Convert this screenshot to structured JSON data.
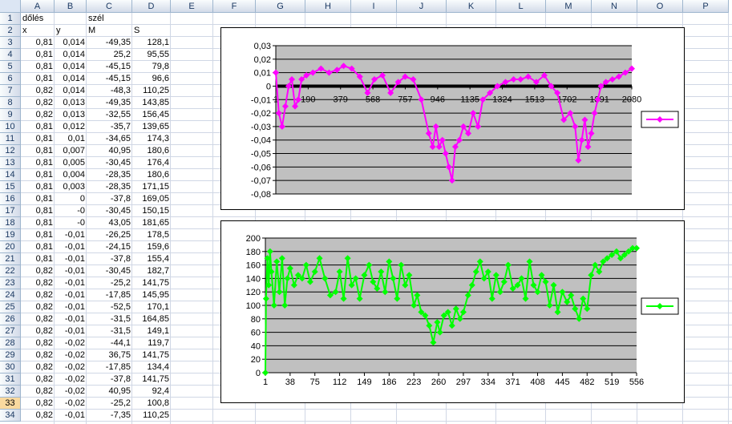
{
  "spreadsheet": {
    "columns": [
      "A",
      "B",
      "C",
      "D",
      "E",
      "F",
      "G",
      "H",
      "I",
      "J",
      "K",
      "L",
      "M",
      "N",
      "O",
      "P"
    ],
    "rows": [
      "1",
      "2",
      "3",
      "4",
      "5",
      "6",
      "7",
      "8",
      "9",
      "10",
      "11",
      "12",
      "13",
      "14",
      "15",
      "16",
      "17",
      "18",
      "19",
      "20",
      "21",
      "22",
      "23",
      "24",
      "25",
      "26",
      "27",
      "28",
      "29",
      "30",
      "31",
      "32",
      "33",
      "34"
    ],
    "selected_row": "33",
    "cells": {
      "A1": "dőlés",
      "C1": "szél",
      "A2": "x",
      "B2": "y",
      "C2": "M",
      "D2": "S"
    },
    "table": [
      [
        "0,81",
        "0,014",
        "-49,35",
        "128,1"
      ],
      [
        "0,81",
        "0,014",
        "25,2",
        "95,55"
      ],
      [
        "0,81",
        "0,014",
        "-45,15",
        "79,8"
      ],
      [
        "0,81",
        "0,014",
        "-45,15",
        "96,6"
      ],
      [
        "0,82",
        "0,014",
        "-48,3",
        "110,25"
      ],
      [
        "0,82",
        "0,013",
        "-49,35",
        "143,85"
      ],
      [
        "0,82",
        "0,013",
        "-32,55",
        "156,45"
      ],
      [
        "0,81",
        "0,012",
        "-35,7",
        "139,65"
      ],
      [
        "0,81",
        "0,01",
        "-34,65",
        "174,3"
      ],
      [
        "0,81",
        "0,007",
        "40,95",
        "180,6"
      ],
      [
        "0,81",
        "0,005",
        "-30,45",
        "176,4"
      ],
      [
        "0,81",
        "0,004",
        "-28,35",
        "180,6"
      ],
      [
        "0,81",
        "0,003",
        "-28,35",
        "171,15"
      ],
      [
        "0,81",
        "0",
        "-37,8",
        "169,05"
      ],
      [
        "0,81",
        "-0",
        "-30,45",
        "150,15"
      ],
      [
        "0,81",
        "-0",
        "43,05",
        "181,65"
      ],
      [
        "0,81",
        "-0,01",
        "-26,25",
        "178,5"
      ],
      [
        "0,81",
        "-0,01",
        "-24,15",
        "159,6"
      ],
      [
        "0,81",
        "-0,01",
        "-37,8",
        "155,4"
      ],
      [
        "0,82",
        "-0,01",
        "-30,45",
        "182,7"
      ],
      [
        "0,82",
        "-0,01",
        "-25,2",
        "141,75"
      ],
      [
        "0,82",
        "-0,01",
        "-17,85",
        "145,95"
      ],
      [
        "0,82",
        "-0,01",
        "-52,5",
        "170,1"
      ],
      [
        "0,82",
        "-0,01",
        "-31,5",
        "164,85"
      ],
      [
        "0,82",
        "-0,01",
        "-31,5",
        "149,1"
      ],
      [
        "0,82",
        "-0,02",
        "-44,1",
        "119,7"
      ],
      [
        "0,82",
        "-0,02",
        "36,75",
        "141,75"
      ],
      [
        "0,82",
        "-0,02",
        "-17,85",
        "134,4"
      ],
      [
        "0,82",
        "-0,02",
        "-37,8",
        "141,75"
      ],
      [
        "0,82",
        "-0,02",
        "40,95",
        "92,4"
      ],
      [
        "0,82",
        "-0,02",
        "-25,2",
        "100,8"
      ],
      [
        "0,82",
        "-0,01",
        "-7,35",
        "110,25"
      ]
    ]
  },
  "chart_data": [
    {
      "type": "line",
      "color": "#ff00ff",
      "plot_bg": "#c0c0c0",
      "grid": true,
      "legend": "right",
      "ylim": [
        -0.08,
        0.03
      ],
      "yticks": [
        "0,03",
        "0,02",
        "0,01",
        "0",
        "-0,01",
        "-0,02",
        "-0,03",
        "-0,04",
        "-0,05",
        "-0,06",
        "-0,07",
        "-0,08"
      ],
      "xticks": [
        "1",
        "190",
        "379",
        "568",
        "757",
        "946",
        "1135",
        "1324",
        "1513",
        "1702",
        "1891",
        "2080"
      ],
      "x": [
        1,
        20,
        40,
        60,
        80,
        100,
        120,
        140,
        160,
        190,
        230,
        280,
        330,
        379,
        420,
        470,
        520,
        568,
        610,
        660,
        710,
        757,
        800,
        850,
        900,
        946,
        970,
        990,
        1010,
        1030,
        1050,
        1070,
        1090,
        1110,
        1135,
        1160,
        1190,
        1220,
        1250,
        1280,
        1324,
        1370,
        1420,
        1470,
        1513,
        1560,
        1610,
        1660,
        1702,
        1740,
        1780,
        1820,
        1850,
        1870,
        1891,
        1910,
        1930,
        1950,
        1970,
        1990,
        2010,
        2040,
        2080,
        2120,
        2160,
        2200
      ],
      "values": [
        0.01,
        -0.02,
        -0.03,
        -0.015,
        0.0,
        0.005,
        -0.015,
        -0.01,
        0.005,
        0.008,
        0.01,
        0.013,
        0.01,
        0.012,
        0.015,
        0.013,
        0.007,
        -0.005,
        0.005,
        0.008,
        -0.005,
        0.003,
        0.007,
        0.005,
        -0.01,
        -0.035,
        -0.045,
        -0.03,
        -0.045,
        -0.04,
        -0.05,
        -0.06,
        -0.07,
        -0.045,
        -0.04,
        -0.03,
        -0.035,
        -0.02,
        -0.03,
        -0.01,
        -0.005,
        0.0,
        0.003,
        0.005,
        0.005,
        0.007,
        0.003,
        0.008,
        0.0,
        -0.005,
        -0.025,
        -0.02,
        -0.03,
        -0.055,
        -0.04,
        -0.025,
        -0.045,
        -0.035,
        -0.02,
        -0.01,
        0.0,
        0.003,
        0.005,
        0.007,
        0.01,
        0.013
      ]
    },
    {
      "type": "line",
      "color": "#00ff00",
      "plot_bg": "#c0c0c0",
      "grid": true,
      "legend": "right",
      "ylim": [
        0,
        200
      ],
      "yticks": [
        "200",
        "180",
        "160",
        "140",
        "120",
        "100",
        "80",
        "60",
        "40",
        "20",
        "0"
      ],
      "xticks": [
        "1",
        "38",
        "75",
        "112",
        "149",
        "186",
        "223",
        "260",
        "297",
        "334",
        "371",
        "408",
        "445",
        "482",
        "519",
        "556"
      ],
      "x": [
        1,
        2,
        4,
        6,
        8,
        10,
        14,
        18,
        22,
        26,
        30,
        34,
        38,
        44,
        50,
        56,
        62,
        68,
        75,
        82,
        90,
        98,
        106,
        112,
        118,
        124,
        130,
        136,
        142,
        149,
        156,
        162,
        168,
        174,
        180,
        186,
        192,
        198,
        204,
        210,
        216,
        223,
        228,
        234,
        240,
        246,
        252,
        258,
        262,
        268,
        274,
        280,
        286,
        292,
        297,
        304,
        310,
        316,
        322,
        328,
        334,
        340,
        346,
        352,
        358,
        364,
        371,
        378,
        384,
        390,
        396,
        402,
        408,
        414,
        420,
        426,
        432,
        438,
        445,
        452,
        458,
        464,
        470,
        476,
        482,
        488,
        494,
        500,
        506,
        512,
        519,
        526,
        532,
        538,
        544,
        550,
        556
      ],
      "values": [
        0,
        110,
        170,
        130,
        180,
        150,
        100,
        165,
        120,
        170,
        100,
        140,
        155,
        130,
        145,
        140,
        160,
        135,
        150,
        170,
        140,
        115,
        120,
        150,
        110,
        170,
        130,
        140,
        110,
        145,
        160,
        135,
        125,
        150,
        120,
        165,
        140,
        110,
        160,
        130,
        145,
        100,
        115,
        90,
        85,
        70,
        45,
        75,
        60,
        85,
        90,
        70,
        95,
        80,
        90,
        115,
        130,
        150,
        165,
        140,
        150,
        110,
        145,
        120,
        135,
        160,
        125,
        130,
        140,
        110,
        165,
        130,
        120,
        145,
        135,
        100,
        130,
        90,
        120,
        105,
        115,
        95,
        80,
        110,
        95,
        145,
        160,
        150,
        165,
        170,
        175,
        180,
        170,
        175,
        180,
        185,
        185
      ]
    }
  ]
}
